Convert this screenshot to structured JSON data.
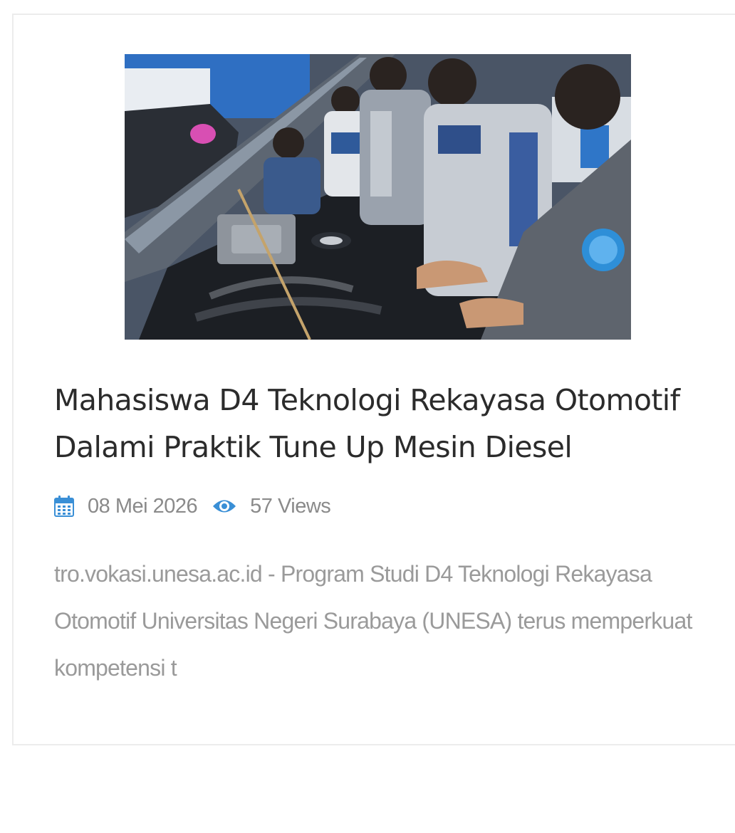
{
  "post": {
    "title": "Mahasiswa D4 Teknologi Rekayasa Otomotif Dalami Praktik Tune Up Mesin Diesel",
    "date": "08 Mei 2026",
    "views": "57 Views",
    "excerpt": "tro.vokasi.unesa.ac.id - Program Studi D4 Teknologi Rekayasa Otomotif Universitas Negeri Surabaya (UNESA) terus memperkuat kompetensi t",
    "image_alt": "Mahasiswa D4 Teknologi Rekayasa Otomotif Dalami Praktik Tune Up Mesin Diesel"
  },
  "icons": {
    "calendar": "calendar-icon",
    "views": "eye-icon"
  },
  "colors": {
    "accent": "#3a8fd6",
    "title": "#2b2b2b",
    "meta": "#8a8a8a",
    "excerpt": "#9a9a9a",
    "border": "#ececec"
  }
}
